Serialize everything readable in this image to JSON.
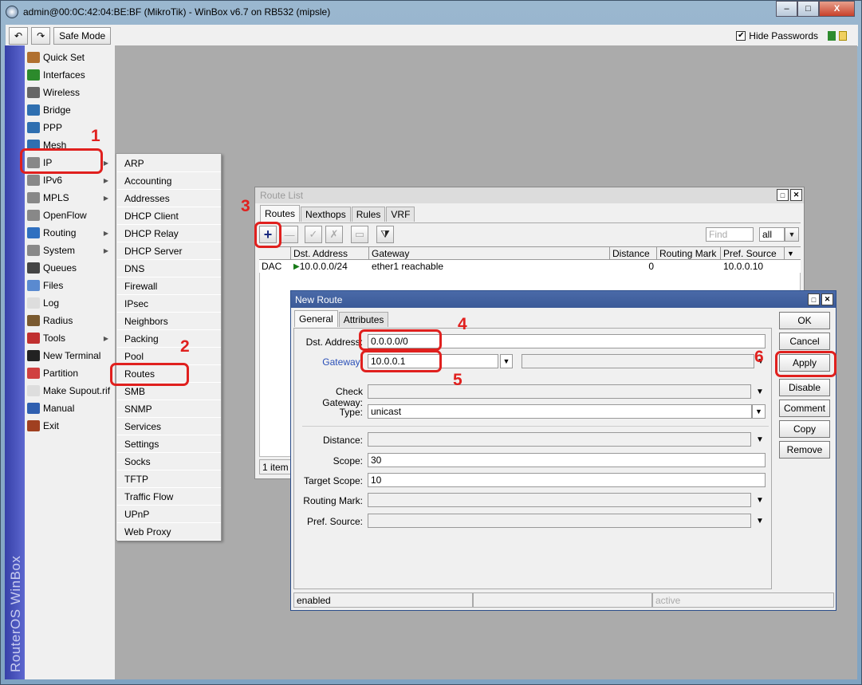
{
  "window": {
    "title": "admin@00:0C:42:04:BE:BF (MikroTik) - WinBox v6.7 on RB532 (mipsle)",
    "minimize": "–",
    "maximize": "□",
    "close": "X"
  },
  "toolbar": {
    "undo": "↶",
    "redo": "↷",
    "safe_mode": "Safe Mode",
    "hide_passwords": "Hide Passwords",
    "hide_passwords_checked": "✔"
  },
  "sidebar_brand": "RouterOS WinBox",
  "menu": [
    {
      "label": "Quick Set",
      "icon": "quickset-icon",
      "color": "#b07030"
    },
    {
      "label": "Interfaces",
      "icon": "interfaces-icon",
      "color": "#2c8a2c"
    },
    {
      "label": "Wireless",
      "icon": "wireless-icon",
      "color": "#666666"
    },
    {
      "label": "Bridge",
      "icon": "bridge-icon",
      "color": "#2f6fb0"
    },
    {
      "label": "PPP",
      "icon": "ppp-icon",
      "color": "#2f6fb0"
    },
    {
      "label": "Mesh",
      "icon": "mesh-icon",
      "color": "#2f6fb0"
    },
    {
      "label": "IP",
      "icon": "ip-icon",
      "color": "#888888",
      "submenu": true
    },
    {
      "label": "IPv6",
      "icon": "ipv6-icon",
      "color": "#888888",
      "submenu": true
    },
    {
      "label": "MPLS",
      "icon": "mpls-icon",
      "color": "#888888",
      "submenu": true
    },
    {
      "label": "OpenFlow",
      "icon": "openflow-icon",
      "color": "#888888"
    },
    {
      "label": "Routing",
      "icon": "routing-icon",
      "color": "#3070c0",
      "submenu": true
    },
    {
      "label": "System",
      "icon": "system-icon",
      "color": "#888888",
      "submenu": true
    },
    {
      "label": "Queues",
      "icon": "queues-icon",
      "color": "#444444"
    },
    {
      "label": "Files",
      "icon": "files-icon",
      "color": "#5a8ad0"
    },
    {
      "label": "Log",
      "icon": "log-icon",
      "color": "#dddddd"
    },
    {
      "label": "Radius",
      "icon": "radius-icon",
      "color": "#7a5a30"
    },
    {
      "label": "Tools",
      "icon": "tools-icon",
      "color": "#c03030",
      "submenu": true
    },
    {
      "label": "New Terminal",
      "icon": "terminal-icon",
      "color": "#222222"
    },
    {
      "label": "Partition",
      "icon": "partition-icon",
      "color": "#d04040"
    },
    {
      "label": "Make Supout.rif",
      "icon": "supout-icon",
      "color": "#dddddd"
    },
    {
      "label": "Manual",
      "icon": "manual-icon",
      "color": "#2f5fb0"
    },
    {
      "label": "Exit",
      "icon": "exit-icon",
      "color": "#a04020"
    }
  ],
  "ip_submenu": [
    "ARP",
    "Accounting",
    "Addresses",
    "DHCP Client",
    "DHCP Relay",
    "DHCP Server",
    "DNS",
    "Firewall",
    "IPsec",
    "Neighbors",
    "Packing",
    "Pool",
    "Routes",
    "SMB",
    "SNMP",
    "Services",
    "Settings",
    "Socks",
    "TFTP",
    "Traffic Flow",
    "UPnP",
    "Web Proxy"
  ],
  "annotations": [
    "1",
    "2",
    "3",
    "4",
    "5",
    "6"
  ],
  "route_list": {
    "title": "Route List",
    "tabs": [
      "Routes",
      "Nexthops",
      "Rules",
      "VRF"
    ],
    "add_icon": "+",
    "remove_icon": "—",
    "enable_icon": "✓",
    "disable_icon": "✗",
    "comment_icon": "▭",
    "filter_icon": "⧩",
    "find_placeholder": "Find",
    "filter_value": "all",
    "columns": [
      "",
      "Dst. Address",
      "Gateway",
      "Distance",
      "Routing Mark",
      "Pref. Source"
    ],
    "rows": [
      {
        "flags": "DAC",
        "dst": "10.0.0.0/24",
        "gateway": "ether1 reachable",
        "distance": "0",
        "mark": "",
        "pref": "10.0.0.10"
      }
    ],
    "status": "1 item"
  },
  "new_route": {
    "title": "New Route",
    "tabs": [
      "General",
      "Attributes"
    ],
    "labels": {
      "dst": "Dst. Address:",
      "gateway": "Gateway:",
      "check_gateway": "Check Gateway:",
      "type": "Type:",
      "distance": "Distance:",
      "scope": "Scope:",
      "target_scope": "Target Scope:",
      "routing_mark": "Routing Mark:",
      "pref_source": "Pref. Source:"
    },
    "values": {
      "dst": "0.0.0.0/0",
      "gateway": "10.0.0.1",
      "type": "unicast",
      "scope": "30",
      "target_scope": "10"
    },
    "buttons": [
      "OK",
      "Cancel",
      "Apply",
      "Disable",
      "Comment",
      "Copy",
      "Remove"
    ],
    "status": [
      "enabled",
      "",
      "active"
    ]
  }
}
